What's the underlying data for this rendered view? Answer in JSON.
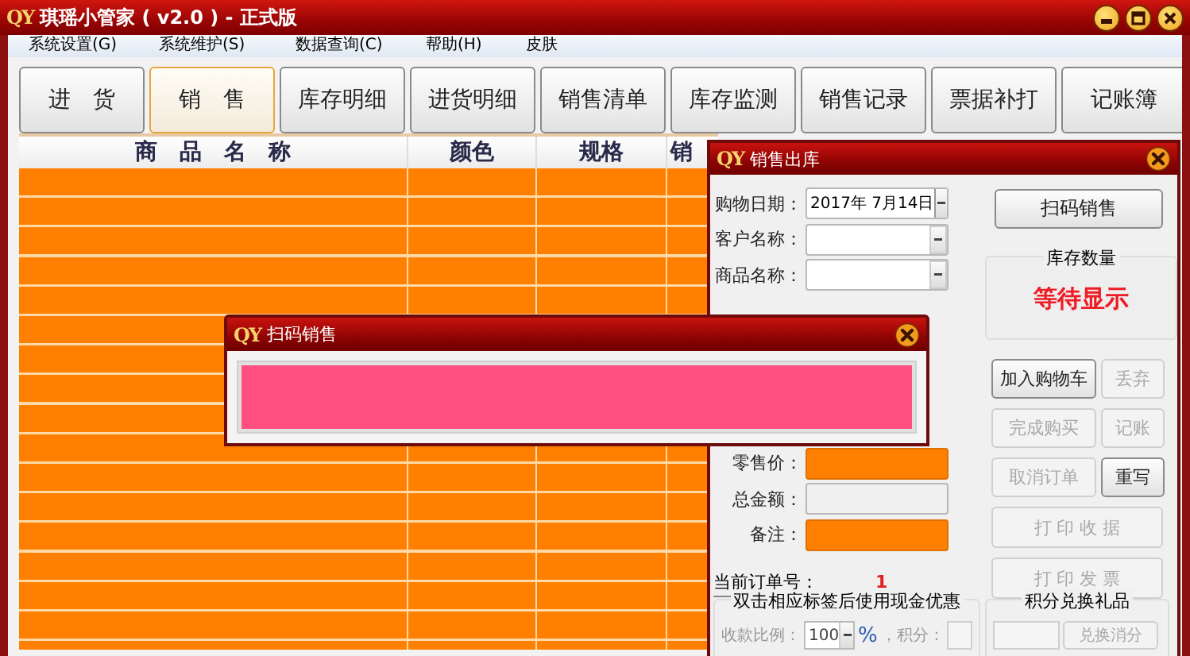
{
  "window": {
    "logo": "QY",
    "title": "琪瑶小管家 ( v2.0 ) - 正式版"
  },
  "menu": [
    {
      "label": "系统设置(G)"
    },
    {
      "label": "系统维护(S)"
    },
    {
      "label": "数据查询(C)"
    },
    {
      "label": "帮助(H)"
    },
    {
      "label": "皮肤"
    }
  ],
  "toolbar": [
    {
      "label": "进　货",
      "selected": false
    },
    {
      "label": "销　售",
      "selected": true
    },
    {
      "label": "库存明细",
      "selected": false
    },
    {
      "label": "进货明细",
      "selected": false
    },
    {
      "label": "销售清单",
      "selected": false
    },
    {
      "label": "库存监测",
      "selected": false
    },
    {
      "label": "销售记录",
      "selected": false
    },
    {
      "label": "票据补打",
      "selected": false
    },
    {
      "label": "记账簿",
      "selected": false
    }
  ],
  "table": {
    "columns": [
      "商　品　名　称",
      "颜色",
      "规格",
      "销"
    ]
  },
  "sales_window": {
    "logo": "QY",
    "title": "销售出库",
    "top_fields": [
      {
        "label": "购物日期：",
        "kind": "date",
        "value": "2017年 7月14日",
        "highlighted": false
      },
      {
        "label": "客户名称：",
        "kind": "combo",
        "highlighted": false
      },
      {
        "label": "商品名称：",
        "kind": "combo",
        "highlighted": false
      }
    ],
    "lower_fields": [
      {
        "label": "零售价：",
        "kind": "text",
        "highlighted": true
      },
      {
        "label": "总金额：",
        "kind": "text",
        "highlighted": false
      },
      {
        "label": "备注：",
        "kind": "text",
        "highlighted": true
      }
    ],
    "order": {
      "label": "当前订单号：",
      "value": "1"
    },
    "scan_button": "扫码销售",
    "stock": {
      "title": "库存数量",
      "value": "等待显示"
    },
    "buttons": [
      {
        "label": "加入购物车",
        "disabled": false
      },
      {
        "label": "丢弃",
        "disabled": true
      },
      {
        "label": "完成购买",
        "disabled": true
      },
      {
        "label": "记账",
        "disabled": true
      },
      {
        "label": "取消订单",
        "disabled": true
      },
      {
        "label": "重写",
        "disabled": false
      }
    ],
    "print_buttons": [
      {
        "label": "打 印 收 据",
        "disabled": true
      },
      {
        "label": "打 印 发 票",
        "disabled": true
      }
    ],
    "discount": {
      "title": "双击相应标签后使用现金优惠",
      "ratio_label": "收款比例：",
      "ratio": "100",
      "unit": "%",
      "points_label": "，积分："
    },
    "points": {
      "title": "积分兑换礼品",
      "button": {
        "label": "兑换消分",
        "disabled": true
      }
    }
  },
  "scan_dialog": {
    "logo": "QY",
    "title": "扫码销售"
  }
}
